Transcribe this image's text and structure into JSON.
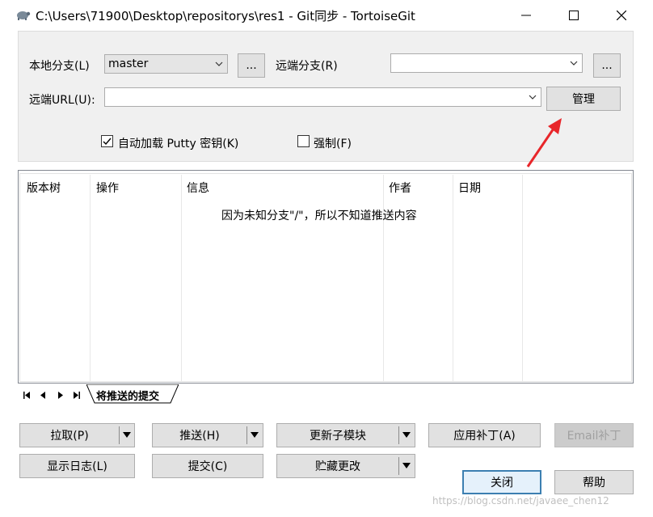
{
  "window": {
    "title": "C:\\Users\\71900\\Desktop\\repositorys\\res1 - Git同步 - TortoiseGit",
    "app_icon": "tortoise-icon"
  },
  "form": {
    "local_branch_label": "本地分支(L)",
    "local_branch_value": "master",
    "local_browse": "...",
    "remote_branch_label": "远端分支(R)",
    "remote_branch_value": "",
    "remote_browse": "...",
    "remote_url_label": "远端URL(U):",
    "remote_url_value": "",
    "manage_button": "管理",
    "auto_load_putty_label": "自动加载 Putty 密钥(K)",
    "auto_load_putty_checked": true,
    "force_label": "强制(F)",
    "force_checked": false
  },
  "list": {
    "columns": [
      "版本树",
      "操作",
      "信息",
      "作者",
      "日期"
    ],
    "empty_message": "因为未知分支\"/\"，所以不知道推送内容"
  },
  "tabs": {
    "active": "将推送的提交"
  },
  "buttons": {
    "pull": "拉取(P)",
    "push": "推送(H)",
    "update_submodules": "更新子模块",
    "apply_patch": "应用补丁(A)",
    "email_patch": "Email补丁",
    "show_log": "显示日志(L)",
    "commit": "提交(C)",
    "stash": "贮藏更改",
    "close": "关闭",
    "help": "帮助"
  },
  "watermark": "https://blog.csdn.net/javaee_chen12",
  "colors": {
    "accent": "#0078d7",
    "annotation_arrow": "#e8262a",
    "disabled_text": "#a0a0a0"
  }
}
